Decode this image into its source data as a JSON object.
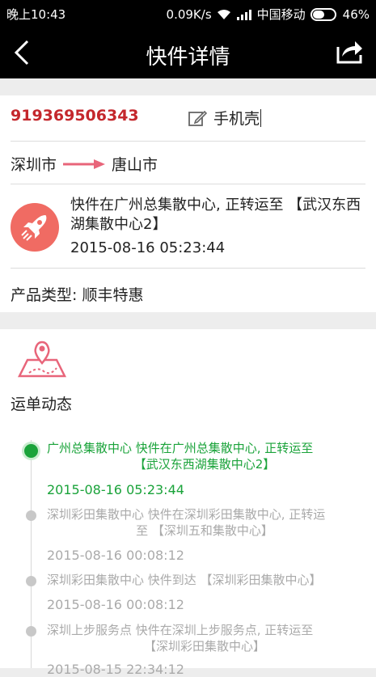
{
  "status_bar": {
    "time": "晚上10:43",
    "speed": "0.09K/s",
    "carrier": "中国移动",
    "battery": "46%"
  },
  "header": {
    "title": "快件详情"
  },
  "shipment": {
    "tracking_number": "919369506343",
    "note": "手机壳",
    "from_city": "深圳市",
    "to_city": "唐山市",
    "latest_status": "快件在广州总集散中心, 正转运至 【武汉东西湖集散中心2】",
    "latest_time": "2015-08-16 05:23:44",
    "product_type_label": "产品类型: 顺丰特惠"
  },
  "tracking_section": {
    "title": "运单动态"
  },
  "events": [
    {
      "line1": "广州总集散中心 快件在广州总集散中心, 正转运至",
      "line2": "【武汉东西湖集散中心2】",
      "time": "2015-08-16 05:23:44"
    },
    {
      "line1": "深圳彩田集散中心 快件在深圳彩田集散中心, 正转运",
      "line2": "至 【深圳五和集散中心】",
      "time": "2015-08-16 00:08:12"
    },
    {
      "line1": "深圳彩田集散中心 快件到达 【深圳彩田集散中心】",
      "line2": "",
      "time": "2015-08-16 00:08:12"
    },
    {
      "line1": "深圳上步服务点 快件在深圳上步服务点, 正转运至",
      "line2": "【深圳彩田集散中心】",
      "time": "2015-08-15 22:34:12"
    }
  ],
  "colors": {
    "accent_red": "#c4272c",
    "green": "#1aa33a",
    "coral": "#f06b63"
  }
}
